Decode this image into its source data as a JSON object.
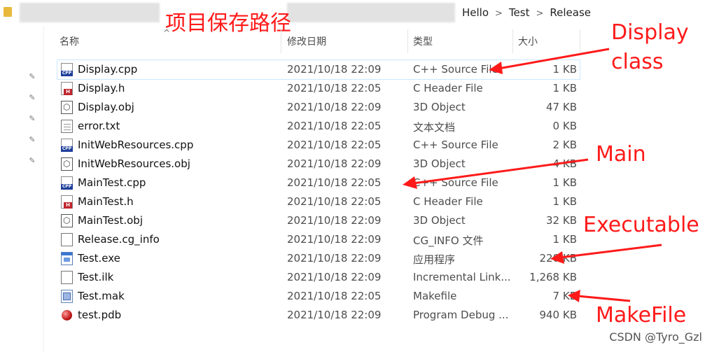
{
  "breadcrumb": [
    "Hello",
    "Test",
    "Release"
  ],
  "breadcrumb_separator": ">",
  "annotations": {
    "title": "项目保存路径",
    "display_line1": "Display",
    "display_line2": "class",
    "main": "Main",
    "executable": "Executable",
    "makefile": "MakeFile",
    "color": "#ff1a1a"
  },
  "columns": {
    "name": "名称",
    "date": "修改日期",
    "type": "类型",
    "size": "大小"
  },
  "files": [
    {
      "name": "Display.cpp",
      "date": "2021/10/18 22:09",
      "type": "C++ Source File",
      "size": "1 KB",
      "icon": "cpp-file-icon"
    },
    {
      "name": "Display.h",
      "date": "2021/10/18 22:05",
      "type": "C Header File",
      "size": "1 KB",
      "icon": "header-file-icon"
    },
    {
      "name": "Display.obj",
      "date": "2021/10/18 22:09",
      "type": "3D Object",
      "size": "47 KB",
      "icon": "object-file-icon"
    },
    {
      "name": "error.txt",
      "date": "2021/10/18 22:05",
      "type": "文本文档",
      "size": "0 KB",
      "icon": "text-file-icon"
    },
    {
      "name": "InitWebResources.cpp",
      "date": "2021/10/18 22:05",
      "type": "C++ Source File",
      "size": "2 KB",
      "icon": "cpp-file-icon"
    },
    {
      "name": "InitWebResources.obj",
      "date": "2021/10/18 22:09",
      "type": "3D Object",
      "size": "4 KB",
      "icon": "object-file-icon"
    },
    {
      "name": "MainTest.cpp",
      "date": "2021/10/18 22:05",
      "type": "C++ Source File",
      "size": "1 KB",
      "icon": "cpp-file-icon"
    },
    {
      "name": "MainTest.h",
      "date": "2021/10/18 22:05",
      "type": "C Header File",
      "size": "1 KB",
      "icon": "header-file-icon"
    },
    {
      "name": "MainTest.obj",
      "date": "2021/10/18 22:09",
      "type": "3D Object",
      "size": "32 KB",
      "icon": "object-file-icon"
    },
    {
      "name": "Release.cg_info",
      "date": "2021/10/18 22:09",
      "type": "CG_INFO 文件",
      "size": "1 KB",
      "icon": "blank-file-icon"
    },
    {
      "name": "Test.exe",
      "date": "2021/10/18 22:09",
      "type": "应用程序",
      "size": "220 KB",
      "icon": "executable-file-icon"
    },
    {
      "name": "Test.ilk",
      "date": "2021/10/18 22:09",
      "type": "Incremental Link...",
      "size": "1,268 KB",
      "icon": "incremental-link-file-icon"
    },
    {
      "name": "Test.mak",
      "date": "2021/10/18 22:05",
      "type": "Makefile",
      "size": "7 KB",
      "icon": "makefile-icon"
    },
    {
      "name": "test.pdb",
      "date": "2021/10/18 22:09",
      "type": "Program Debug ...",
      "size": "940 KB",
      "icon": "debug-database-file-icon"
    }
  ],
  "watermark": "CSDN @Tyro_Gzl"
}
